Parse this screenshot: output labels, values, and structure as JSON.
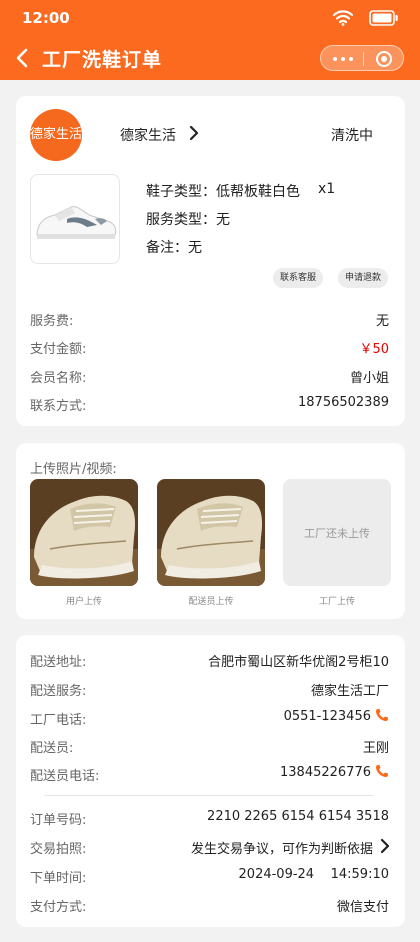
{
  "status_bar": {
    "time": "12:00"
  },
  "nav": {
    "title": "工厂洗鞋订单"
  },
  "order": {
    "logo_text": "德家生活",
    "shop_name": "德家生活",
    "status": "清洗中",
    "shoe_type": "鞋子类型：低帮板鞋白色",
    "quantity": "x1",
    "service_type": "服务类型：无",
    "remark": "备注：无",
    "contact_button": "联系客服",
    "refund_button": "申请退款",
    "rows": [
      {
        "label": "服务费:",
        "value": "无"
      },
      {
        "label": "支付金额:",
        "value": "￥50"
      },
      {
        "label": "会员名称:",
        "value": "曾小姐"
      },
      {
        "label": "联系方式:",
        "value": "18756502389"
      }
    ]
  },
  "upload": {
    "title": "上传照片/视频:",
    "factory_placeholder": "工厂还未上传",
    "captions": [
      "用户上传",
      "配送员上传",
      "工厂上传"
    ]
  },
  "delivery": {
    "rows": [
      {
        "label": "配送地址:",
        "value": "合肥市蜀山区新华优阁2号柜10"
      },
      {
        "label": "配送服务:",
        "value": "德家生活工厂"
      },
      {
        "label": "工厂电话:",
        "value": "0551-123456"
      },
      {
        "label": "配送员:",
        "value": "王刚"
      },
      {
        "label": "配送员电话:",
        "value": "13845226776"
      }
    ],
    "order_rows": [
      {
        "label": "订单号码:",
        "value": "2210 2265 6154 6154 3518"
      },
      {
        "label": "交易拍照:",
        "value": "发生交易争议，可作为判断依据"
      },
      {
        "label": "下单时间:",
        "value": "2024-09-24    14:59:10"
      },
      {
        "label": "支付方式:",
        "value": "微信支付"
      }
    ]
  },
  "colors": {
    "brand": "#fb6a1e",
    "price": "#e60000"
  }
}
